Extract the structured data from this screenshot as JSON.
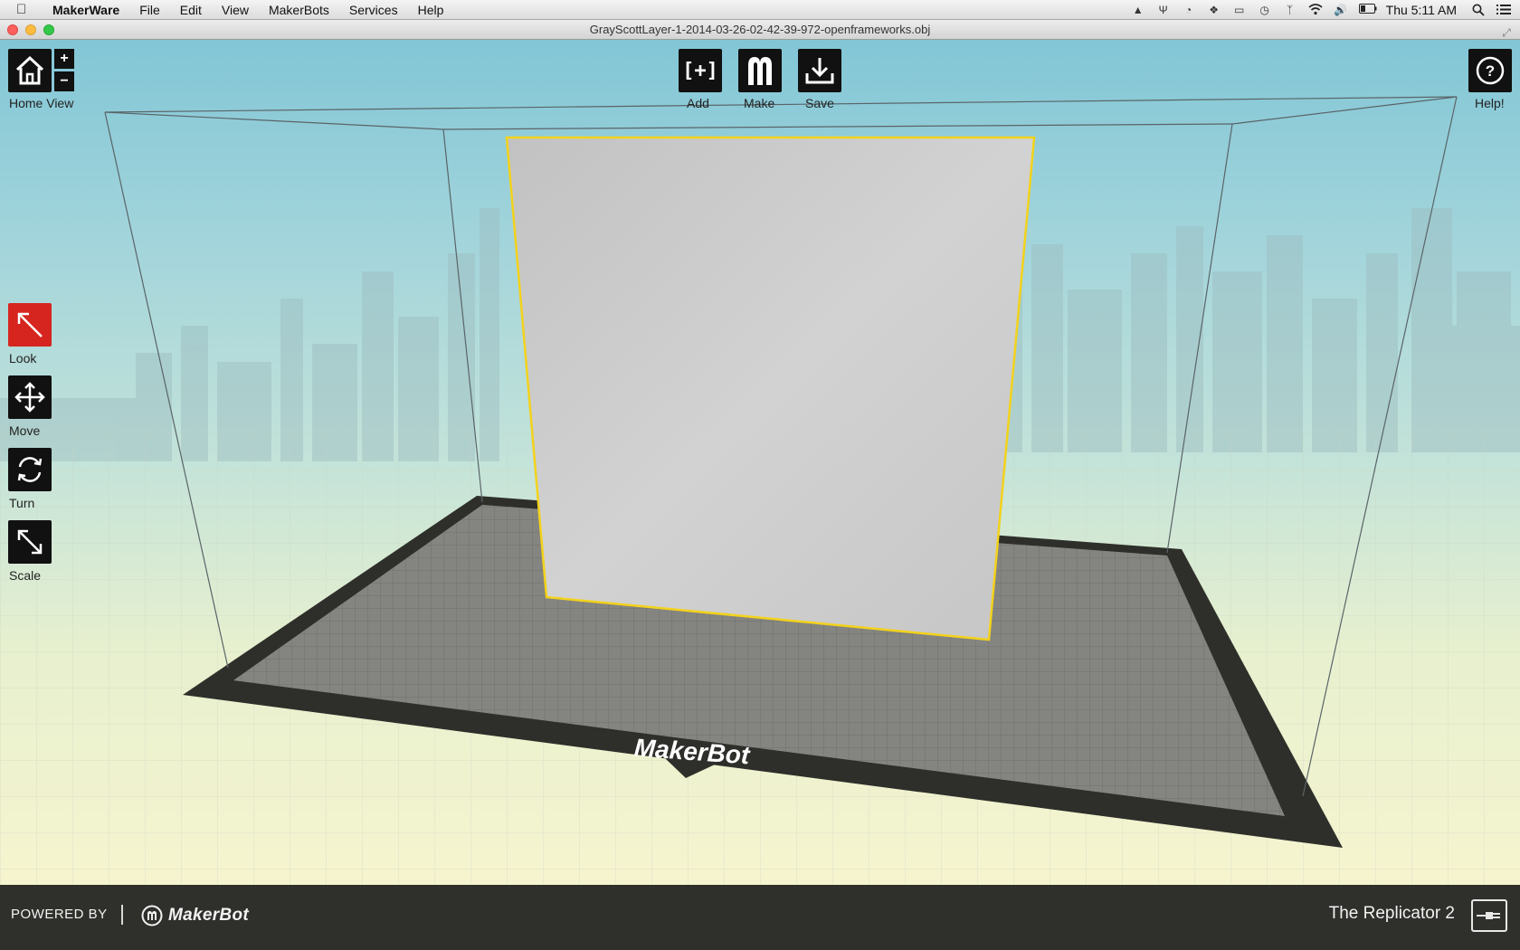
{
  "menubar": {
    "app_name": "MakerWare",
    "menus": [
      "File",
      "Edit",
      "View",
      "MakerBots",
      "Services",
      "Help"
    ],
    "clock": "Thu 5:11 AM"
  },
  "window": {
    "title": "GrayScottLayer-1-2014-03-26-02-42-39-972-openframeworks.obj"
  },
  "toolbar": {
    "home_label": "Home View",
    "zoom_in": "+",
    "zoom_out": "−",
    "add_label": "Add",
    "add_glyph": "[+]",
    "make_label": "Make",
    "save_label": "Save",
    "help_label": "Help!",
    "help_glyph": "?"
  },
  "side_tools": {
    "look_label": "Look",
    "move_label": "Move",
    "turn_label": "Turn",
    "scale_label": "Scale",
    "active_tool": "Look"
  },
  "plate": {
    "brand": "MakerBot"
  },
  "footer": {
    "powered_by": "POWERED BY",
    "brand": "MakerBot",
    "printer": "The Replicator 2"
  },
  "colors": {
    "active_tool": "#d6251f",
    "selection_outline": "#f3d21b",
    "button_bg": "#111111",
    "footer_bg": "#2f302c"
  }
}
